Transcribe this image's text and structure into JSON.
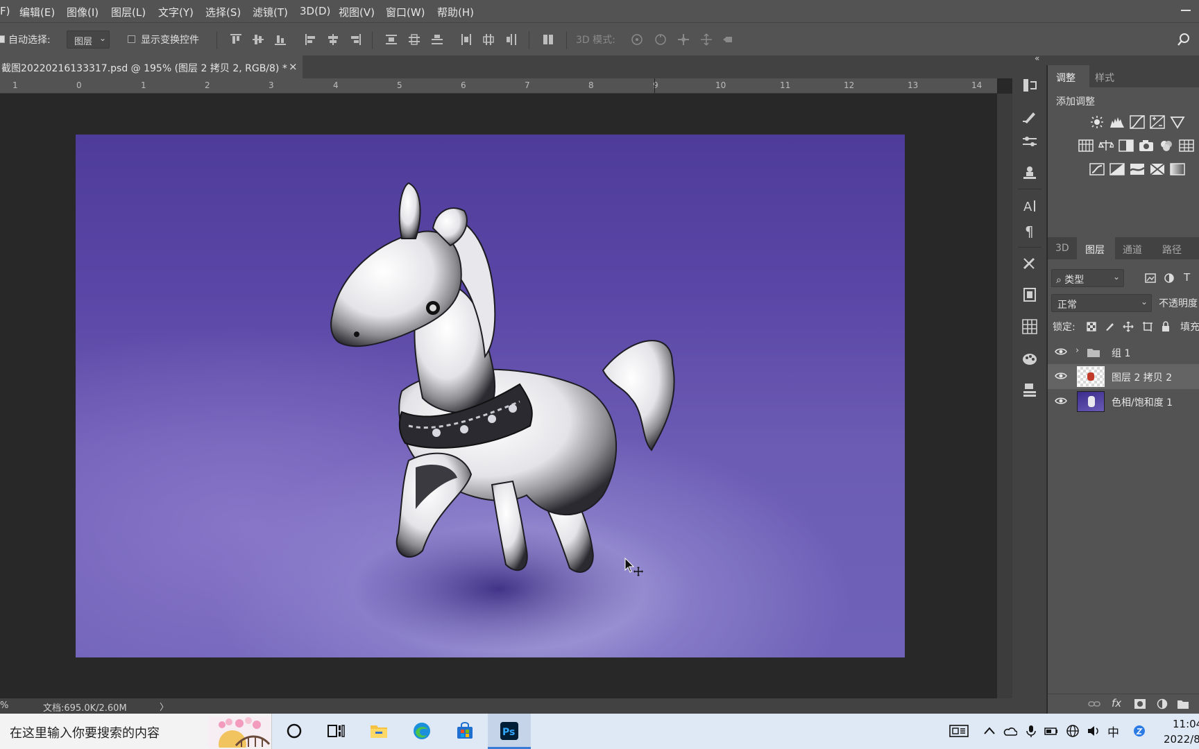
{
  "menubar": {
    "items": [
      "F)",
      "编辑(E)",
      "图像(I)",
      "图层(L)",
      "文字(Y)",
      "选择(S)",
      "滤镜(T)",
      "3D(D)",
      "视图(V)",
      "窗口(W)",
      "帮助(H)"
    ]
  },
  "options": {
    "auto_select_label": "自动选择:",
    "auto_select_value": "图层",
    "show_transform_label": "显示变换控件",
    "mode_3d_label": "3D 模式:"
  },
  "document": {
    "tab_title": "截图20220216133317.psd @ 195% (图层 2 拷贝 2, RGB/8) *",
    "close_glyph": "×"
  },
  "ruler": {
    "ticks": [
      "1",
      "0",
      "1",
      "2",
      "3",
      "4",
      "5",
      "6",
      "7",
      "8",
      "9",
      "10",
      "11",
      "12",
      "13",
      "14"
    ]
  },
  "status": {
    "zoom": "%",
    "doc_size": "文档:695.0K/2.60M",
    "arrow": "〉"
  },
  "panels": {
    "collapse_glyph": "«",
    "adjustments": {
      "tab_active": "调整",
      "tab_inactive": "样式",
      "heading": "添加调整",
      "icons_row1": [
        "brightness-icon",
        "levels-icon",
        "curves-icon",
        "exposure-icon",
        "gradient-triangle-icon"
      ],
      "icons_row2": [
        "vibrance-icon",
        "balance-icon",
        "black-white-icon",
        "photo-filter-icon",
        "channel-mixer-icon",
        "color-lookup-icon"
      ],
      "icons_row3": [
        "invert-icon",
        "posterize-icon",
        "threshold-icon",
        "selective-color-icon",
        "gradient-map-icon"
      ]
    },
    "layers": {
      "tabs": [
        "3D",
        "图层",
        "通道",
        "路径"
      ],
      "filter_label": "类型",
      "blend_mode": "正常",
      "opacity_label": "不透明度",
      "lock_label": "锁定:",
      "fill_label": "填充",
      "items": [
        {
          "name": "组 1",
          "type": "group",
          "selected": false
        },
        {
          "name": "图层 2 拷贝 2",
          "type": "pixel",
          "selected": true
        },
        {
          "name": "色相/饱和度 1",
          "type": "adjustment",
          "selected": false
        }
      ]
    }
  },
  "taskbar": {
    "search_placeholder": "在这里输入你要搜索的内容",
    "ime_label": "中",
    "time": "11:04",
    "date": "2022/8"
  },
  "colors": {
    "ui_dark": "#282828",
    "ui_panel": "#535353",
    "image_purple": "#5a46a6",
    "taskbar": "#dfe9f5",
    "ps_blue": "#31a8ff"
  }
}
